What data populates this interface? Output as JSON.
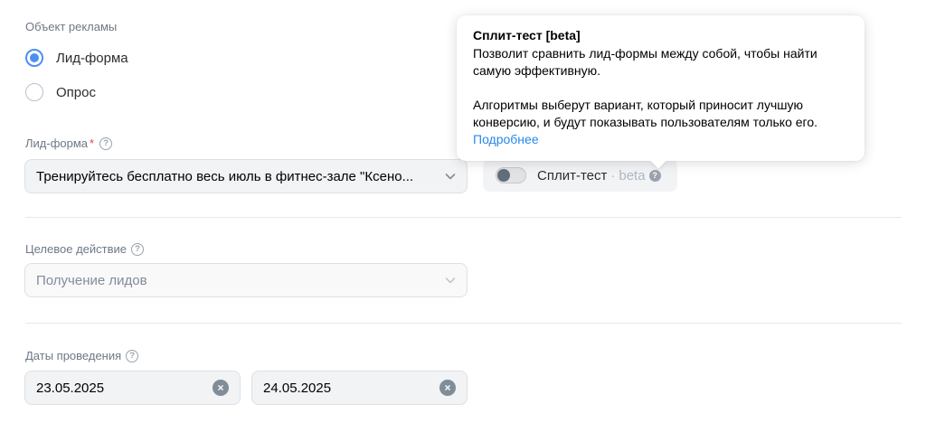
{
  "ad_object": {
    "label": "Объект рекламы",
    "options": [
      {
        "label": "Лид-форма",
        "checked": true
      },
      {
        "label": "Опрос",
        "checked": false
      }
    ]
  },
  "lead_form": {
    "label": "Лид-форма",
    "required_mark": "*",
    "value": "Тренируйтесь бесплатно весь июль в фитнес-зале \"Ксено..."
  },
  "split_test": {
    "label": "Сплит-тест",
    "separator": "·",
    "beta": "beta"
  },
  "tooltip": {
    "title": "Сплит-тест [beta]",
    "line1": "Позволит сравнить лид-формы между собой, чтобы найти",
    "line2": "самую эффективную.",
    "line3": "Алгоритмы выберут вариант, который приносит лучшую",
    "line4": "конверсию, и будут показывать пользователям только его.",
    "link": "Подробнее"
  },
  "target_action": {
    "label": "Целевое действие",
    "value": "Получение лидов"
  },
  "dates": {
    "label": "Даты проведения",
    "start": "23.05.2025",
    "end": "24.05.2025"
  },
  "colors": {
    "accent": "#4d8ff0",
    "link": "#2688eb",
    "required": "#e64646"
  }
}
